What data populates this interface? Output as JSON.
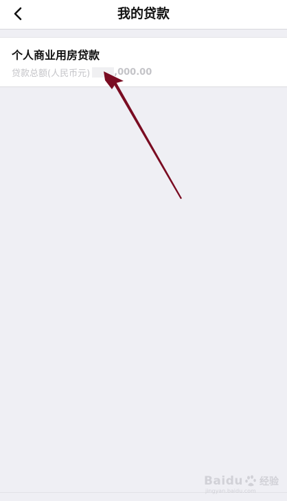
{
  "header": {
    "title": "我的贷款",
    "back_icon": "chevron-left-icon"
  },
  "loans": [
    {
      "name": "个人商业用房贷款",
      "amount_label": "贷款总额(人民币元)",
      "amount_value": ",000.00"
    }
  ],
  "annotation": {
    "arrow_color": "#7a0c22"
  },
  "watermark": {
    "brand": "Baidu",
    "cn": "经验",
    "url": "jingyan.baidu.com"
  }
}
